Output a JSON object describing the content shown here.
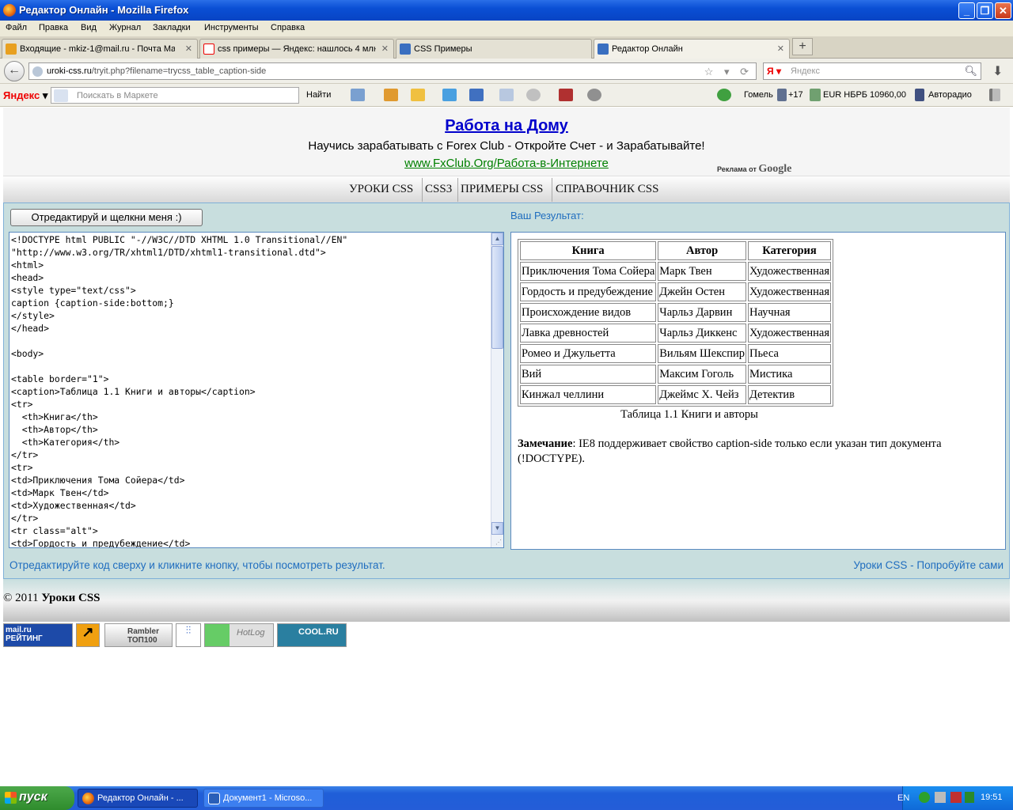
{
  "window": {
    "title": "Редактор Онлайн - Mozilla Firefox",
    "buttons": {
      "minimize": "_",
      "maximize": "❐",
      "close": "✕"
    }
  },
  "menu": [
    "Файл",
    "Правка",
    "Вид",
    "Журнал",
    "Закладки",
    "Инструменты",
    "Справка"
  ],
  "tabs": [
    {
      "label": "Входящие - mkiz-1@mail.ru - Почта Mail....",
      "close": "✕"
    },
    {
      "label": "css примеры — Яндекс: нашлось 4 млн ...",
      "close": "✕"
    },
    {
      "label": "CSS Примеры",
      "close": ""
    },
    {
      "label": "Редактор Онлайн",
      "close": "✕"
    }
  ],
  "newtab_label": "+",
  "nav": {
    "back_icon": "←",
    "url_host": "uroki-css.ru",
    "url_path": "/tryit.php?filename=trycss_table_caption-side",
    "url_icons": "☆ ▾ ⟳",
    "search_engine": "Я ▾",
    "search_placeholder": "Яндекс",
    "download_icon": "⬇"
  },
  "yandex_bar": {
    "logo": "Яндекс",
    "search_placeholder": "Поискать в Маркете",
    "find": "Найти",
    "gomel": "Гомель",
    "temp": "+17",
    "currency": "EUR НБРБ 10960,00",
    "radio": "Авторадио"
  },
  "ad": {
    "title": "Работа на Дому",
    "text": "Научись зарабатывать с Forex Club - Откройте Счет - и Зарабатывайте!",
    "link": "www.FxClub.Org/Работа-в-Интернете",
    "by": "Реклама от",
    "by_brand": "Google"
  },
  "topnav": [
    "УРОКИ CSS",
    "CSS3",
    "ПРИМЕРЫ CSS",
    "СПРАВОЧНИК CSS"
  ],
  "editor": {
    "button": "Отредактируй и щелкни меня :)",
    "result_label": "Ваш Результат:",
    "lines": [
      "<!DOCTYPE html PUBLIC \"-//W3C//DTD XHTML 1.0 Transitional//EN\"",
      "\"http://www.w3.org/TR/xhtml1/DTD/xhtml1-transitional.dtd\">",
      "<html>",
      "<head>",
      "<style type=\"text/css\">",
      "caption {caption-side:bottom;}",
      "</style>",
      "</head>",
      "",
      "<body>",
      "",
      "<table border=\"1\">",
      "<caption>Таблица 1.1 Книги и авторы</caption>",
      "<tr>",
      "  <th>Книга</th>",
      "  <th>Автор</th>",
      "  <th>Категория</th>",
      "</tr>",
      "<tr>",
      "<td>Приключения Тома Сойера</td>",
      "<td>Марк Твен</td>",
      "<td>Художественная</td>",
      "</tr>",
      "<tr class=\"alt\">",
      "<td>Гордость и предубеждение</td>"
    ],
    "scroll_up": "▲",
    "scroll_down": "▼"
  },
  "result": {
    "headers": [
      "Книга",
      "Автор",
      "Категория"
    ],
    "rows": [
      [
        "Приключения Тома Сойера",
        "Марк Твен",
        "Художественная"
      ],
      [
        "Гордость и предубеждение",
        "Джейн Остен",
        "Художественная"
      ],
      [
        "Происхождение видов",
        "Чарльз Дарвин",
        "Научная"
      ],
      [
        "Лавка древностей",
        "Чарльз Диккенс",
        "Художественная"
      ],
      [
        "Ромео и Джульетта",
        "Вильям Шекспир",
        "Пьеса"
      ],
      [
        "Вий",
        "Максим Гоголь",
        "Мистика"
      ],
      [
        "Кинжал челлини",
        "Джеймс Х. Чейз",
        "Детектив"
      ]
    ],
    "caption": "Таблица 1.1 Книги и авторы",
    "note_label": "Замечание",
    "note_text": ": IE8 поддерживает свойство caption-side только если указан тип документа (!DOCTYPE)."
  },
  "hint": "Отредактируйте код сверху и кликните кнопку, чтобы посмотреть результат.",
  "hint_right": "Уроки CSS - Попробуйте сами",
  "footer": {
    "copy": "© 2011",
    "brand": "Уроки CSS"
  },
  "counters": [
    "mail.ru РЕЙТИНГ",
    "↗",
    "Rambler ТОП100",
    "⫶⫶",
    "HotLog",
    "COOL.RU"
  ],
  "taskbar": {
    "start": "пуск",
    "tasks": [
      "Редактор Онлайн - ...",
      "Документ1 - Microso..."
    ],
    "lang": "EN",
    "time": "19:51"
  }
}
